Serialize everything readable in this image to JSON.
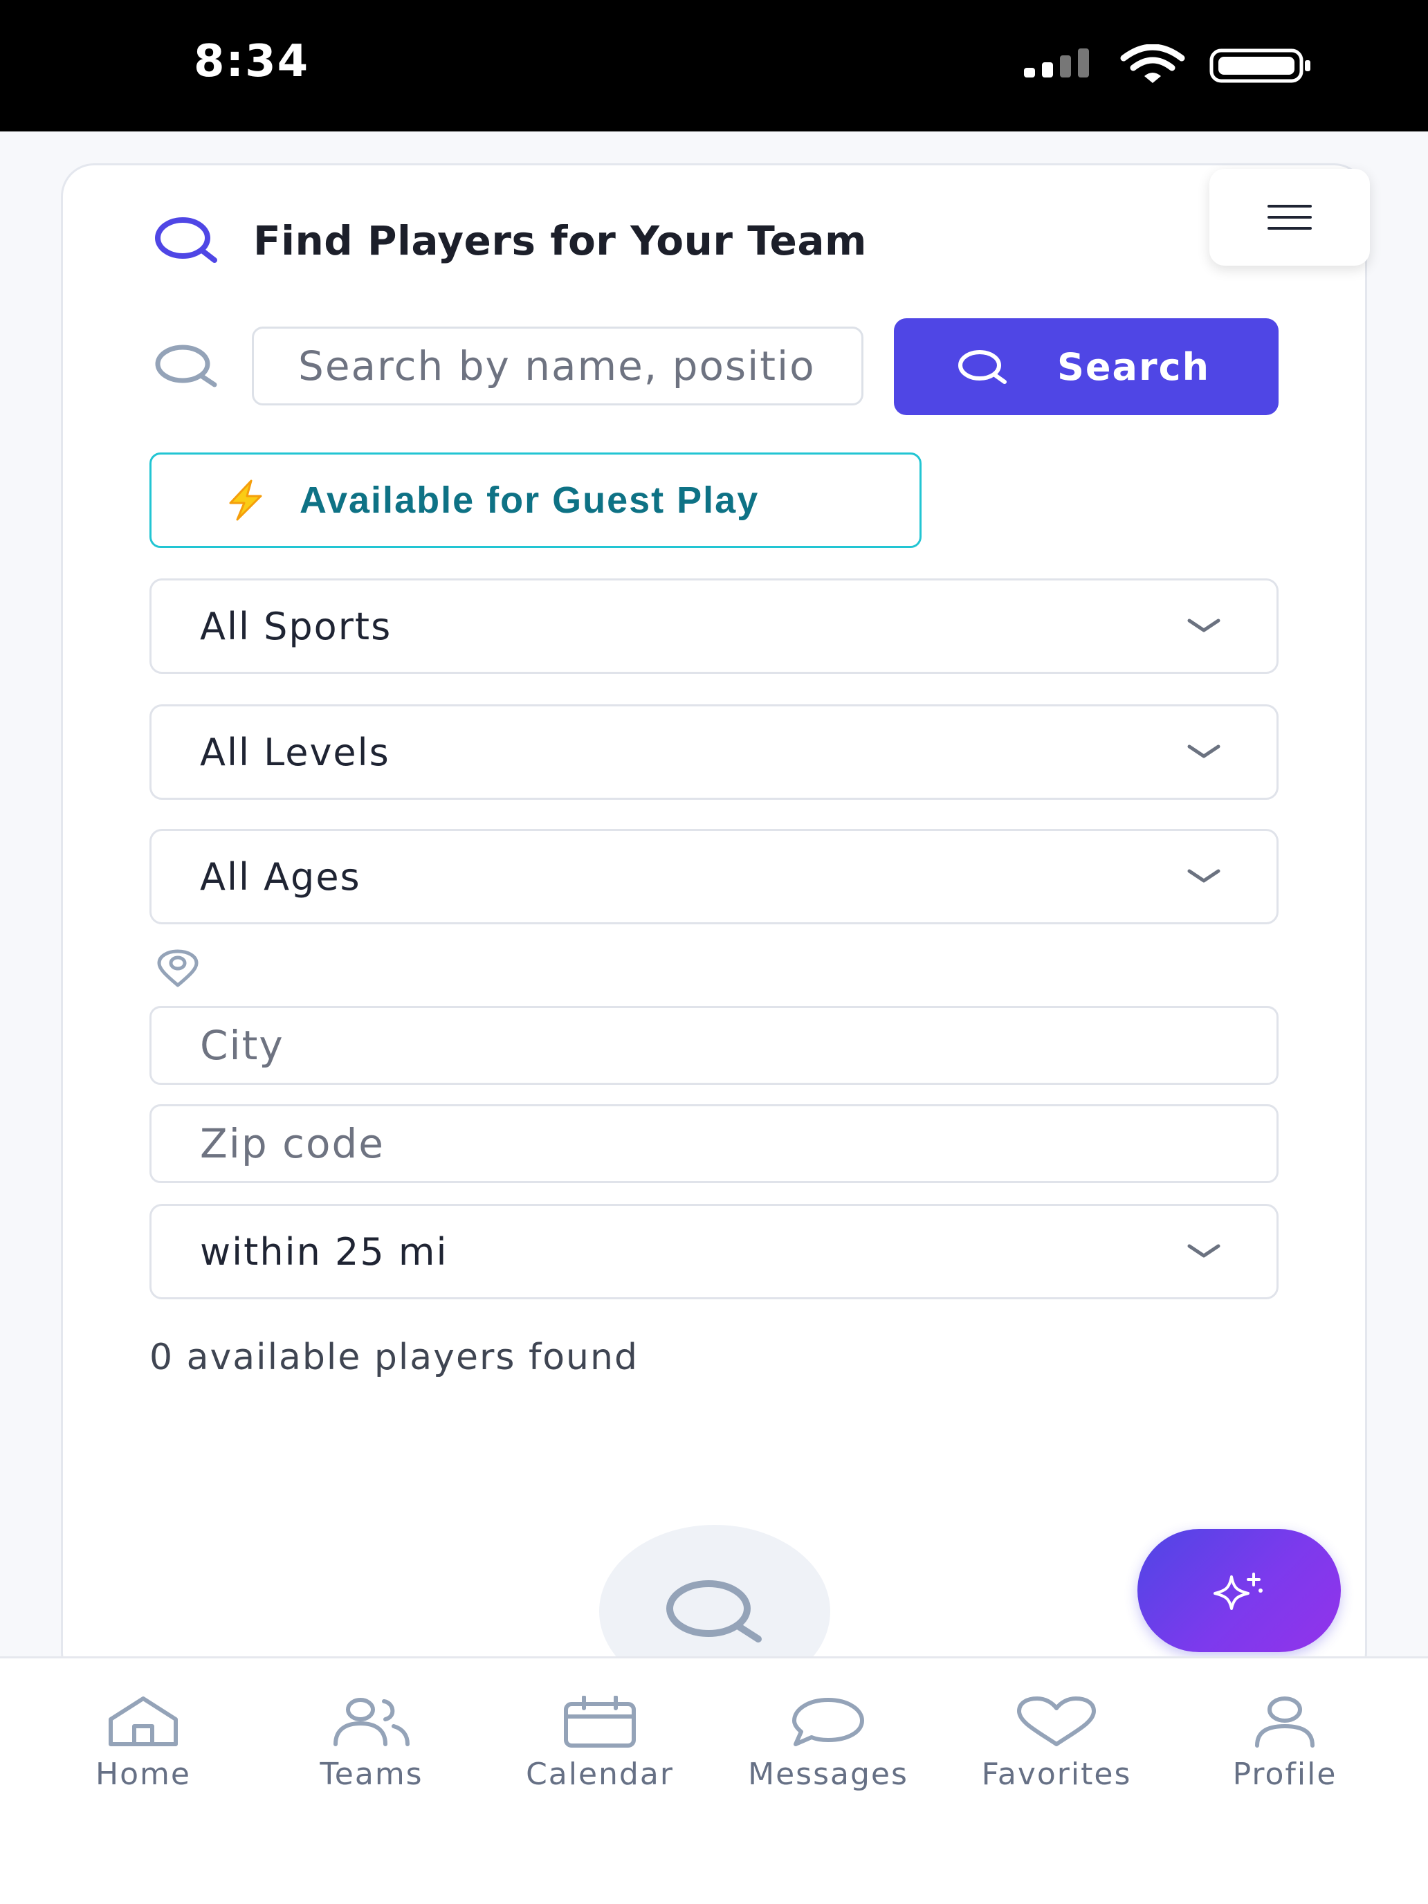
{
  "status_bar": {
    "time": "8:34"
  },
  "header": {
    "title": "Find Players for Your Team"
  },
  "search": {
    "placeholder": "Search by name, position, or sport...",
    "button_label": "Search"
  },
  "guest_play": {
    "label": "Available for Guest Play",
    "icon": "lightning-icon"
  },
  "filters": {
    "sport": {
      "selected": "All Sports"
    },
    "level": {
      "selected": "All Levels"
    },
    "age": {
      "selected": "All Ages"
    },
    "city_placeholder": "City",
    "zip_placeholder": "Zip code",
    "radius": {
      "selected": "within 25 mi"
    }
  },
  "results": {
    "count_text": "0 available players found"
  },
  "bottom_nav": {
    "items": [
      {
        "label": "Home",
        "icon": "home-icon"
      },
      {
        "label": "Teams",
        "icon": "users-icon"
      },
      {
        "label": "Calendar",
        "icon": "calendar-icon"
      },
      {
        "label": "Messages",
        "icon": "message-icon"
      },
      {
        "label": "Favorites",
        "icon": "heart-icon"
      },
      {
        "label": "Profile",
        "icon": "user-icon"
      }
    ]
  },
  "colors": {
    "primary": "#4f46e5",
    "guest_border": "#22c5d3",
    "guest_text": "#0e7285",
    "muted_icon": "#94a3b8",
    "nav_text": "#667085"
  }
}
